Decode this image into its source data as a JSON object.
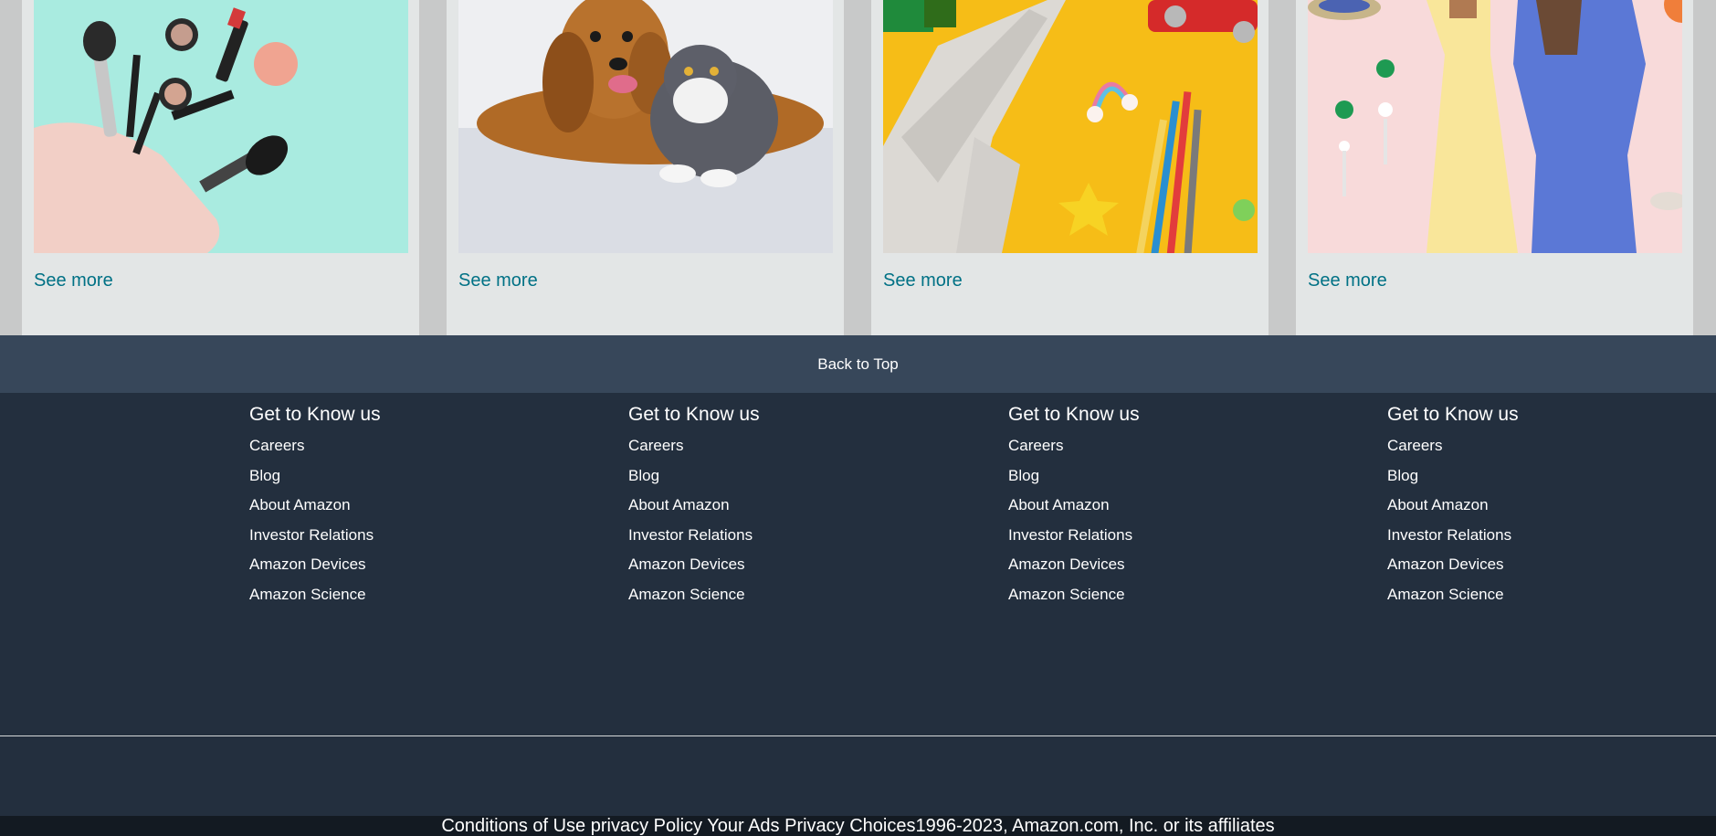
{
  "cards": [
    {
      "image": "makeup-brushes-image",
      "see_more": "See more"
    },
    {
      "image": "dog-and-cat-image",
      "see_more": "See more"
    },
    {
      "image": "toys-and-pencils-image",
      "see_more": "See more"
    },
    {
      "image": "fashion-outfits-image",
      "see_more": "See more"
    }
  ],
  "back_to_top": "Back to Top",
  "footer": {
    "columns": [
      {
        "heading": "Get to Know us",
        "links": [
          "Careers",
          "Blog",
          "About Amazon",
          "Investor Relations",
          "Amazon Devices",
          "Amazon Science"
        ]
      },
      {
        "heading": "Get to Know us",
        "links": [
          "Careers",
          "Blog",
          "About Amazon",
          "Investor Relations",
          "Amazon Devices",
          "Amazon Science"
        ]
      },
      {
        "heading": "Get to Know us",
        "links": [
          "Careers",
          "Blog",
          "About Amazon",
          "Investor Relations",
          "Amazon Devices",
          "Amazon Science"
        ]
      },
      {
        "heading": "Get to Know us",
        "links": [
          "Careers",
          "Blog",
          "About Amazon",
          "Investor Relations",
          "Amazon Devices",
          "Amazon Science"
        ]
      }
    ]
  },
  "bottom": {
    "conditions": "Conditions of Use",
    "privacy": "privacy Policy",
    "ads": "Your Ads Privacy Choices",
    "copyright": "1996-2023, Amazon.com, Inc. or its affiliates"
  },
  "colors": {
    "link_teal": "#007185",
    "back_to_top_bg": "#37475a",
    "footer_bg": "#232f3e",
    "bottom_bg": "#131a22"
  }
}
